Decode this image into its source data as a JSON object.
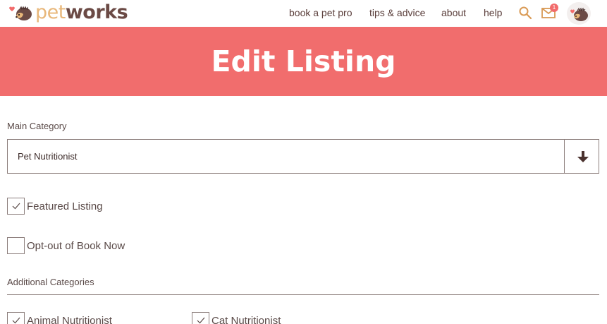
{
  "header": {
    "logo": {
      "part1": "pet",
      "part2": "works"
    },
    "nav": {
      "book": "book a pet pro",
      "tips": "tips & advice",
      "about": "about",
      "help": "help"
    },
    "icons": {
      "search": "search-icon",
      "mail": "mail-icon",
      "avatar": "hedgehog-avatar"
    },
    "mail_badge_count": "1"
  },
  "banner": {
    "title": "Edit Listing"
  },
  "form": {
    "main_category_label": "Main Category",
    "main_category_value": "Pet Nutritionist",
    "featured": {
      "label": "Featured Listing",
      "checked": true
    },
    "optout": {
      "label": "Opt-out of Book Now",
      "checked": false
    },
    "additional_label": "Additional Categories",
    "additional": [
      {
        "label": "Animal Nutritionist",
        "checked": true
      },
      {
        "label": "Cat Nutritionist",
        "checked": true
      }
    ]
  },
  "colors": {
    "banner": "#f16d6d",
    "brand_pet": "#e8b77a",
    "brand_works": "#6b4a45",
    "badge": "#f26b6b"
  }
}
